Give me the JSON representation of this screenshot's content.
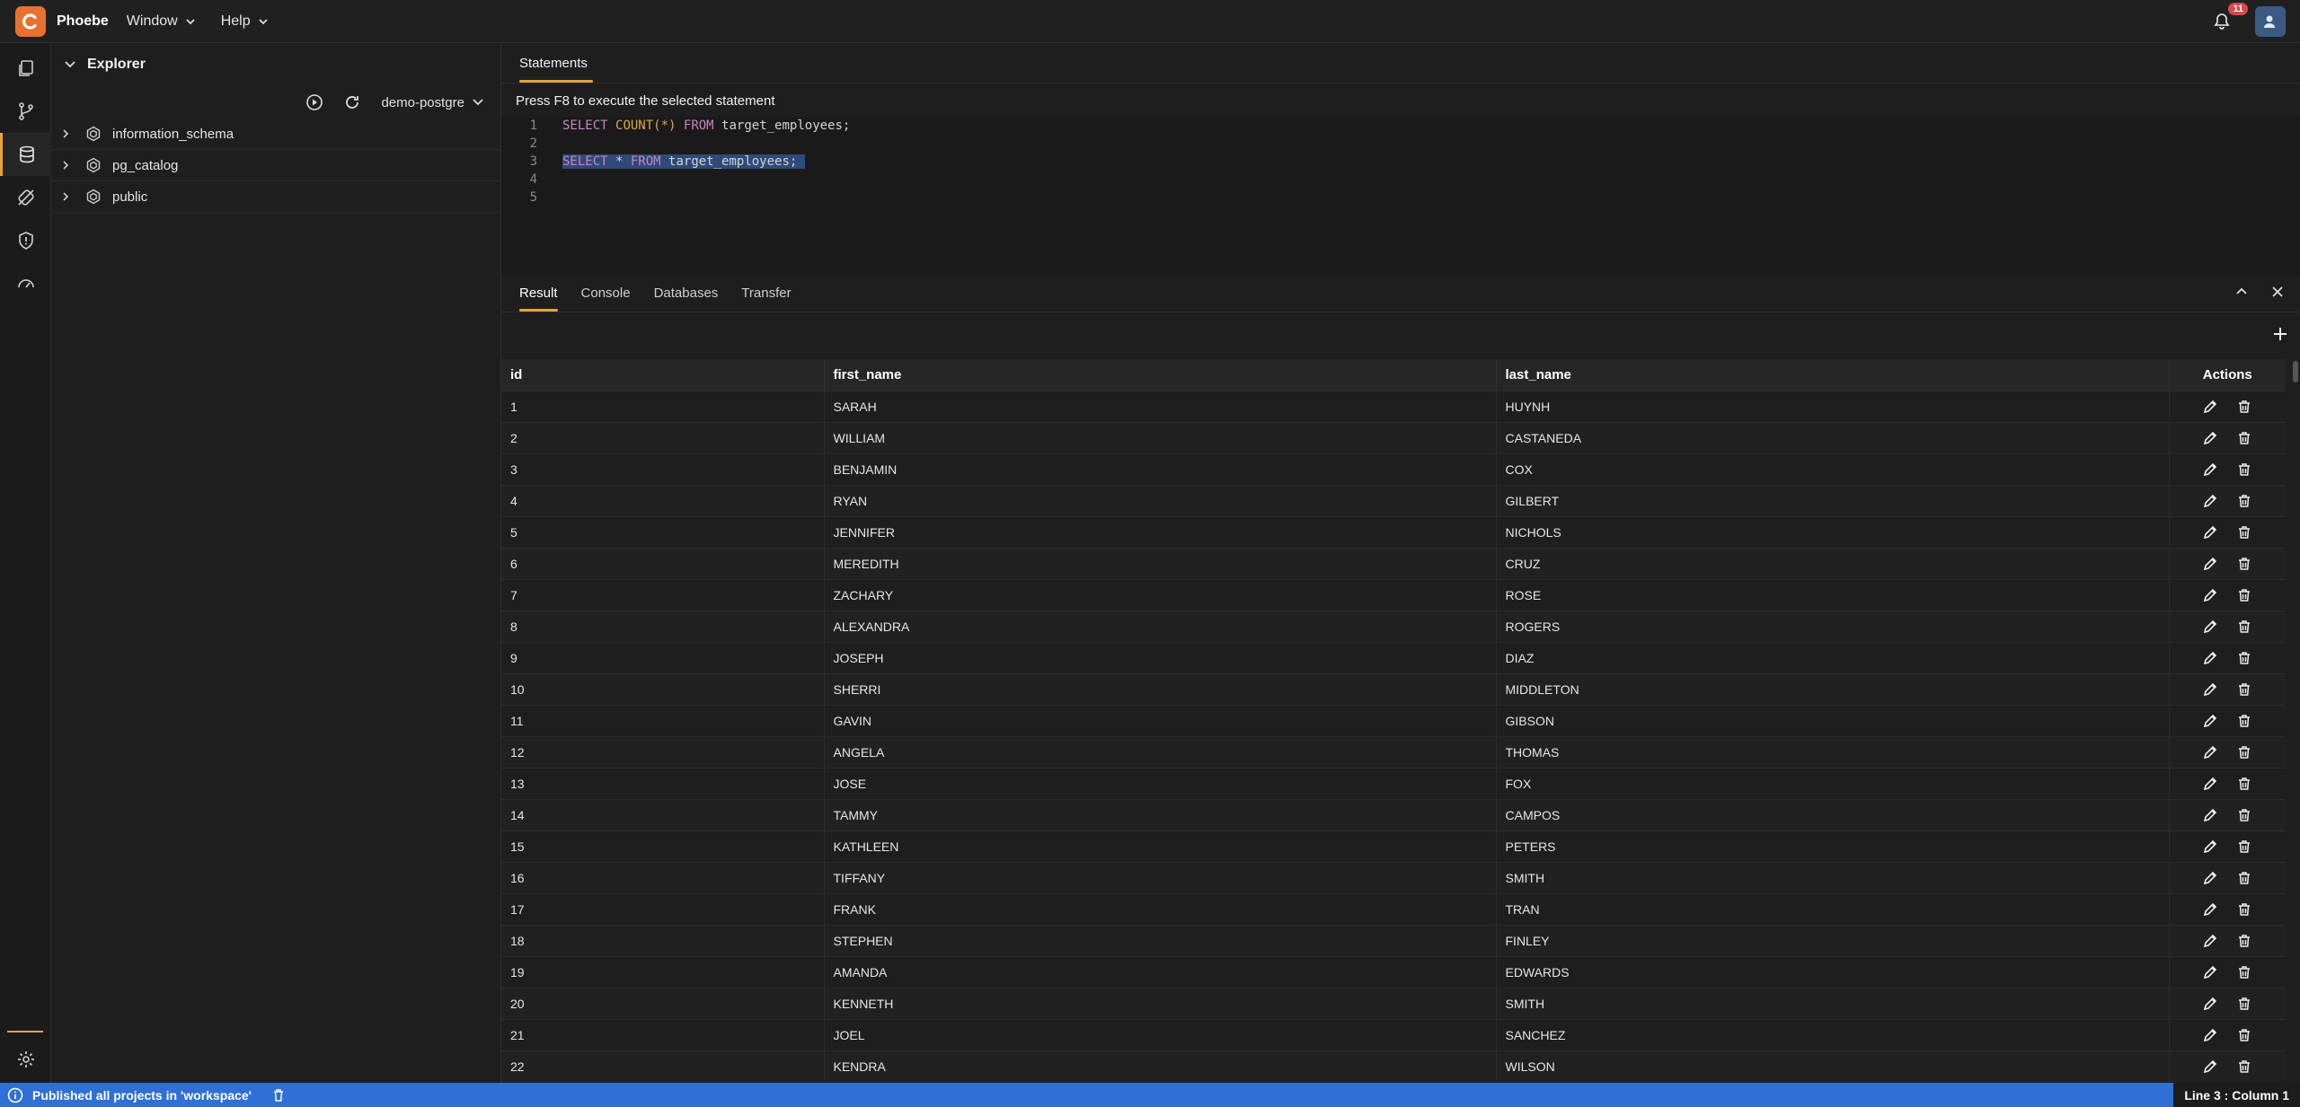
{
  "app": {
    "name": "Phoebe",
    "menus": [
      "Window",
      "Help"
    ],
    "notifications_count": "11"
  },
  "explorer": {
    "title": "Explorer",
    "connection": "demo-postgre",
    "schemas": [
      "information_schema",
      "pg_catalog",
      "public"
    ]
  },
  "statements": {
    "tab_label": "Statements",
    "hint": "Press F8 to execute the selected statement",
    "lines": [
      {
        "num": "1",
        "kw1": "SELECT",
        "fn": "COUNT(*)",
        "kw2": "FROM",
        "rest": "target_employees;"
      },
      {
        "num": "2"
      },
      {
        "num": "3",
        "kw1": "SELECT",
        "mid": " * ",
        "kw2": "FROM",
        "rest": "target_employees;"
      },
      {
        "num": "4"
      },
      {
        "num": "5"
      }
    ]
  },
  "result": {
    "tabs": [
      "Result",
      "Console",
      "Databases",
      "Transfer"
    ],
    "columns": [
      "id",
      "first_name",
      "last_name",
      "Actions"
    ],
    "rows": [
      [
        "1",
        "SARAH",
        "HUYNH"
      ],
      [
        "2",
        "WILLIAM",
        "CASTANEDA"
      ],
      [
        "3",
        "BENJAMIN",
        "COX"
      ],
      [
        "4",
        "RYAN",
        "GILBERT"
      ],
      [
        "5",
        "JENNIFER",
        "NICHOLS"
      ],
      [
        "6",
        "MEREDITH",
        "CRUZ"
      ],
      [
        "7",
        "ZACHARY",
        "ROSE"
      ],
      [
        "8",
        "ALEXANDRA",
        "ROGERS"
      ],
      [
        "9",
        "JOSEPH",
        "DIAZ"
      ],
      [
        "10",
        "SHERRI",
        "MIDDLETON"
      ],
      [
        "11",
        "GAVIN",
        "GIBSON"
      ],
      [
        "12",
        "ANGELA",
        "THOMAS"
      ],
      [
        "13",
        "JOSE",
        "FOX"
      ],
      [
        "14",
        "TAMMY",
        "CAMPOS"
      ],
      [
        "15",
        "KATHLEEN",
        "PETERS"
      ],
      [
        "16",
        "TIFFANY",
        "SMITH"
      ],
      [
        "17",
        "FRANK",
        "TRAN"
      ],
      [
        "18",
        "STEPHEN",
        "FINLEY"
      ],
      [
        "19",
        "AMANDA",
        "EDWARDS"
      ],
      [
        "20",
        "KENNETH",
        "SMITH"
      ],
      [
        "21",
        "JOEL",
        "SANCHEZ"
      ],
      [
        "22",
        "KENDRA",
        "WILSON"
      ]
    ]
  },
  "status": {
    "message": "Published all projects in 'workspace'",
    "cursor": "Line 3 : Column 1"
  },
  "colors": {
    "accent": "#e8a33d",
    "logo": "#e8712d",
    "statusbar": "#2f6fd6",
    "badge": "#d8484e"
  }
}
